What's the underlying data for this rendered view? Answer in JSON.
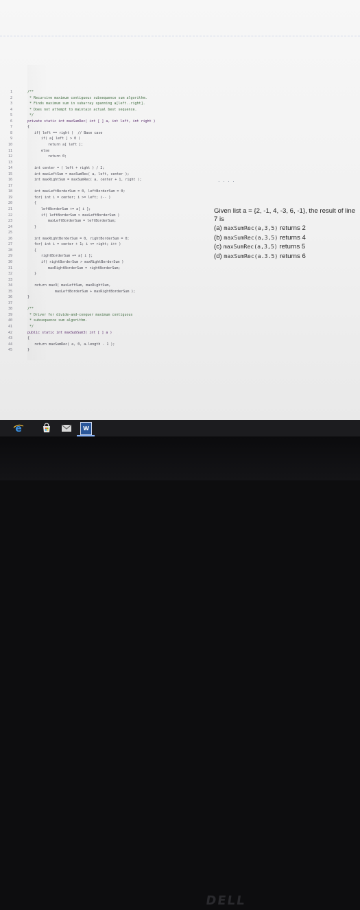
{
  "question": {
    "text": "Given list a = {2, -1, 4, -3, 6, -1}, the result of line 7 is",
    "options": [
      {
        "label": "(a)",
        "call": "maxSumRec(a,3,5)",
        "result": "returns 2"
      },
      {
        "label": "(b)",
        "call": "maxSumRec(a,3,5)",
        "result": "returns 4"
      },
      {
        "label": "(c)",
        "call": "maxSumRec(a,3,5)",
        "result": "returns 5"
      },
      {
        "label": "(d)",
        "call": "maxSumRec(a.3.5)",
        "result": "returns 6"
      }
    ]
  },
  "ellipsis": ". . . .",
  "code_lines": [
    {
      "n": "1",
      "indent": 1,
      "kind": "comment",
      "text": "/**"
    },
    {
      "n": "2",
      "indent": 1,
      "kind": "comment",
      "text": " * Recursive maximum contiguous subsequence sum algorithm."
    },
    {
      "n": "3",
      "indent": 1,
      "kind": "comment",
      "text": " * Finds maximum sum in subarray spanning a[left..right]."
    },
    {
      "n": "4",
      "indent": 1,
      "kind": "comment",
      "text": " * Does not attempt to maintain actual best sequence."
    },
    {
      "n": "5",
      "indent": 1,
      "kind": "comment",
      "text": " */"
    },
    {
      "n": "6",
      "indent": 1,
      "kind": "keyword",
      "text": "private static int maxSumRec( int [ ] a, int left, int right )"
    },
    {
      "n": "7",
      "indent": 1,
      "kind": "code",
      "text": "{"
    },
    {
      "n": "8",
      "indent": 2,
      "kind": "code",
      "text": "if( left == right )  // Base case"
    },
    {
      "n": "9",
      "indent": 3,
      "kind": "code",
      "text": "if( a[ left ] > 0 )"
    },
    {
      "n": "10",
      "indent": 4,
      "kind": "code",
      "text": "return a[ left ];"
    },
    {
      "n": "11",
      "indent": 3,
      "kind": "code",
      "text": "else"
    },
    {
      "n": "12",
      "indent": 4,
      "kind": "code",
      "text": "return 0;"
    },
    {
      "n": "13",
      "indent": 0,
      "kind": "code",
      "text": ""
    },
    {
      "n": "14",
      "indent": 2,
      "kind": "code",
      "text": "int center = ( left + right ) / 2;"
    },
    {
      "n": "15",
      "indent": 2,
      "kind": "code",
      "text": "int maxLeftSum = maxSumRec( a, left, center );"
    },
    {
      "n": "16",
      "indent": 2,
      "kind": "code",
      "text": "int maxRightSum = maxSumRec( a, center + 1, right );"
    },
    {
      "n": "17",
      "indent": 0,
      "kind": "code",
      "text": ""
    },
    {
      "n": "18",
      "indent": 2,
      "kind": "code",
      "text": "int maxLeftBorderSum = 0, leftBorderSum = 0;"
    },
    {
      "n": "19",
      "indent": 2,
      "kind": "code",
      "text": "for( int i = center; i >= left; i-- )"
    },
    {
      "n": "20",
      "indent": 2,
      "kind": "code",
      "text": "{"
    },
    {
      "n": "21",
      "indent": 3,
      "kind": "code",
      "text": "leftBorderSum += a[ i ];"
    },
    {
      "n": "22",
      "indent": 3,
      "kind": "code",
      "text": "if( leftBorderSum > maxLeftBorderSum )"
    },
    {
      "n": "23",
      "indent": 4,
      "kind": "code",
      "text": "maxLeftBorderSum = leftBorderSum;"
    },
    {
      "n": "24",
      "indent": 2,
      "kind": "code",
      "text": "}"
    },
    {
      "n": "25",
      "indent": 0,
      "kind": "code",
      "text": ""
    },
    {
      "n": "26",
      "indent": 2,
      "kind": "code",
      "text": "int maxRightBorderSum = 0, rightBorderSum = 0;"
    },
    {
      "n": "27",
      "indent": 2,
      "kind": "code",
      "text": "for( int i = center + 1; i <= right; i++ )"
    },
    {
      "n": "28",
      "indent": 2,
      "kind": "code",
      "text": "{"
    },
    {
      "n": "29",
      "indent": 3,
      "kind": "code",
      "text": "rightBorderSum += a[ i ];"
    },
    {
      "n": "30",
      "indent": 3,
      "kind": "code",
      "text": "if( rightBorderSum > maxRightBorderSum )"
    },
    {
      "n": "31",
      "indent": 4,
      "kind": "code",
      "text": "maxRightBorderSum = rightBorderSum;"
    },
    {
      "n": "32",
      "indent": 2,
      "kind": "code",
      "text": "}"
    },
    {
      "n": "33",
      "indent": 0,
      "kind": "code",
      "text": ""
    },
    {
      "n": "34",
      "indent": 2,
      "kind": "code",
      "text": "return max3( maxLeftSum, maxRightSum,"
    },
    {
      "n": "35",
      "indent": 5,
      "kind": "code",
      "text": "maxLeftBorderSum + maxRightBorderSum );"
    },
    {
      "n": "36",
      "indent": 1,
      "kind": "code",
      "text": "}"
    },
    {
      "n": "37",
      "indent": 0,
      "kind": "code",
      "text": ""
    },
    {
      "n": "38",
      "indent": 1,
      "kind": "comment",
      "text": "/**"
    },
    {
      "n": "39",
      "indent": 1,
      "kind": "comment",
      "text": " * Driver for divide-and-conquer maximum contiguous"
    },
    {
      "n": "40",
      "indent": 1,
      "kind": "comment",
      "text": " * subsequence sum algorithm."
    },
    {
      "n": "41",
      "indent": 1,
      "kind": "comment",
      "text": " */"
    },
    {
      "n": "42",
      "indent": 1,
      "kind": "keyword",
      "text": "public static int maxSubSum3( int [ ] a )"
    },
    {
      "n": "43",
      "indent": 1,
      "kind": "code",
      "text": "{"
    },
    {
      "n": "44",
      "indent": 2,
      "kind": "code",
      "text": "return maxSumRec( a, 0, a.length - 1 );"
    },
    {
      "n": "45",
      "indent": 1,
      "kind": "code",
      "text": "}"
    }
  ],
  "taskbar": {
    "icons": [
      "internet-explorer-icon",
      "store-icon",
      "mail-icon",
      "word-icon"
    ],
    "word_letter": "W"
  },
  "bezel": {
    "logo": "DELL"
  },
  "colors": {
    "ie": "#3a8fe0",
    "word": "#2b579a",
    "taskbar": "#1c1c1f"
  }
}
